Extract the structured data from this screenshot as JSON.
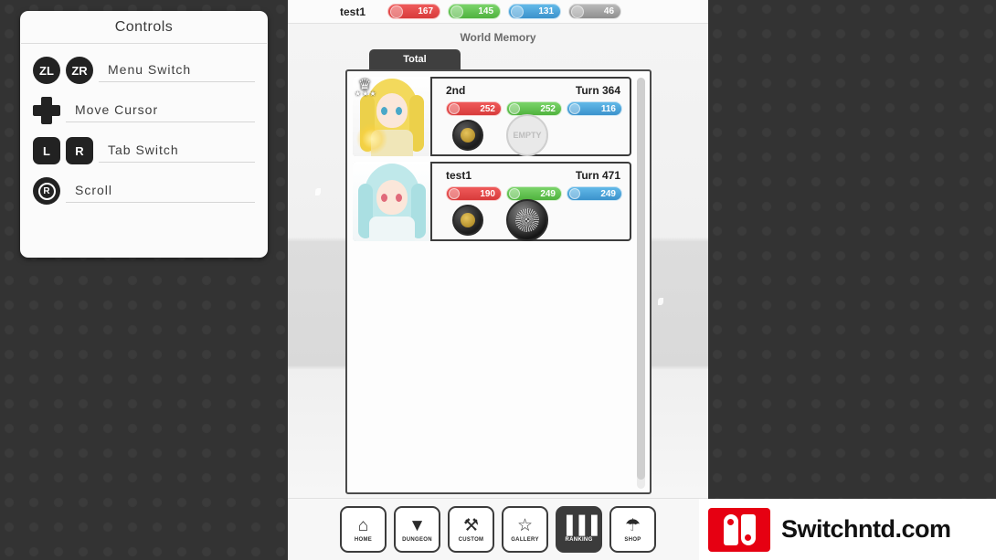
{
  "controls": {
    "title": "Controls",
    "rows": [
      {
        "buttons": [
          "ZL",
          "ZR"
        ],
        "type": "circle",
        "label": "Menu Switch"
      },
      {
        "buttons": [],
        "type": "dpad",
        "label": "Move Cursor"
      },
      {
        "buttons": [
          "L",
          "R"
        ],
        "type": "square",
        "label": "Tab Switch"
      },
      {
        "buttons": [
          "R"
        ],
        "type": "ring",
        "label": "Scroll"
      }
    ]
  },
  "game": {
    "player_name": "test1",
    "resources": [
      {
        "name": "red-resource",
        "value": "167",
        "color": "#d83b3b"
      },
      {
        "name": "green-resource",
        "value": "145",
        "color": "#4fb23d"
      },
      {
        "name": "blue-resource",
        "value": "131",
        "color": "#3b92cc"
      },
      {
        "name": "gray-resource",
        "value": "46",
        "color": "#8f8f8f"
      }
    ],
    "screen_title": "World Memory",
    "tabs": [
      {
        "label": "Total",
        "active": true
      }
    ],
    "ranking": [
      {
        "rank_label": "2nd",
        "turn_label": "Turn 364",
        "stats": [
          {
            "name": "hp-stat",
            "value": "252",
            "color": "#d83b3b"
          },
          {
            "name": "atk-stat",
            "value": "252",
            "color": "#4fb23d"
          },
          {
            "name": "def-stat",
            "value": "116",
            "color": "#3b92cc"
          }
        ],
        "badge_small": "medal-icon",
        "badge_large": "empty-slot",
        "badge_large_label": "EMPTY",
        "crown": true,
        "stars": "★★★",
        "hair_color": "#f3d95c",
        "body_color": "#f0e6b8"
      },
      {
        "rank_label": "test1",
        "turn_label": "Turn 471",
        "stats": [
          {
            "name": "hp-stat",
            "value": "190",
            "color": "#d83b3b"
          },
          {
            "name": "atk-stat",
            "value": "249",
            "color": "#4fb23d"
          },
          {
            "name": "def-stat",
            "value": "249",
            "color": "#3b92cc"
          }
        ],
        "badge_small": "medal-icon",
        "badge_large": "sphere-icon",
        "badge_large_label": "",
        "crown": false,
        "stars": "",
        "hair_color": "#bfe8ea",
        "body_color": "#eef6f7"
      }
    ],
    "nav": [
      {
        "glyph": "⌂",
        "label": "HOME",
        "name": "nav-home",
        "active": false
      },
      {
        "glyph": "▼",
        "label": "DUNGEON",
        "name": "nav-dungeon",
        "active": false
      },
      {
        "glyph": "⚒",
        "label": "CUSTOM",
        "name": "nav-custom",
        "active": false
      },
      {
        "glyph": "☆",
        "label": "GALLERY",
        "name": "nav-gallery",
        "active": false
      },
      {
        "glyph": "▐▐▐",
        "label": "RANKING",
        "name": "nav-ranking",
        "active": true
      },
      {
        "glyph": "☂",
        "label": "SHOP",
        "name": "nav-shop",
        "active": false
      }
    ]
  },
  "watermark": {
    "text": "Switchntd.com"
  }
}
